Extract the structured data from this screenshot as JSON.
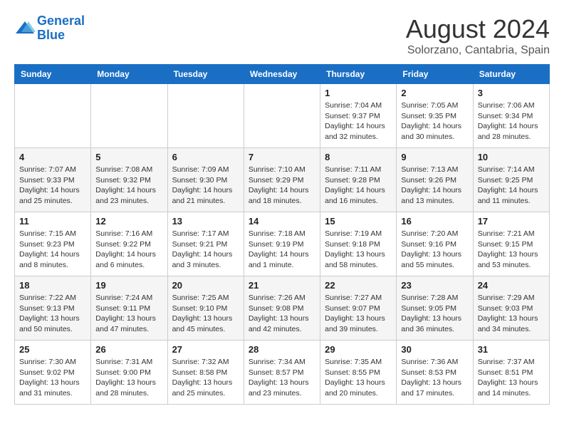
{
  "header": {
    "logo_line1": "General",
    "logo_line2": "Blue",
    "month_year": "August 2024",
    "location": "Solorzano, Cantabria, Spain"
  },
  "days_of_week": [
    "Sunday",
    "Monday",
    "Tuesday",
    "Wednesday",
    "Thursday",
    "Friday",
    "Saturday"
  ],
  "weeks": [
    [
      {
        "day": "",
        "info": ""
      },
      {
        "day": "",
        "info": ""
      },
      {
        "day": "",
        "info": ""
      },
      {
        "day": "",
        "info": ""
      },
      {
        "day": "1",
        "info": "Sunrise: 7:04 AM\nSunset: 9:37 PM\nDaylight: 14 hours\nand 32 minutes."
      },
      {
        "day": "2",
        "info": "Sunrise: 7:05 AM\nSunset: 9:35 PM\nDaylight: 14 hours\nand 30 minutes."
      },
      {
        "day": "3",
        "info": "Sunrise: 7:06 AM\nSunset: 9:34 PM\nDaylight: 14 hours\nand 28 minutes."
      }
    ],
    [
      {
        "day": "4",
        "info": "Sunrise: 7:07 AM\nSunset: 9:33 PM\nDaylight: 14 hours\nand 25 minutes."
      },
      {
        "day": "5",
        "info": "Sunrise: 7:08 AM\nSunset: 9:32 PM\nDaylight: 14 hours\nand 23 minutes."
      },
      {
        "day": "6",
        "info": "Sunrise: 7:09 AM\nSunset: 9:30 PM\nDaylight: 14 hours\nand 21 minutes."
      },
      {
        "day": "7",
        "info": "Sunrise: 7:10 AM\nSunset: 9:29 PM\nDaylight: 14 hours\nand 18 minutes."
      },
      {
        "day": "8",
        "info": "Sunrise: 7:11 AM\nSunset: 9:28 PM\nDaylight: 14 hours\nand 16 minutes."
      },
      {
        "day": "9",
        "info": "Sunrise: 7:13 AM\nSunset: 9:26 PM\nDaylight: 14 hours\nand 13 minutes."
      },
      {
        "day": "10",
        "info": "Sunrise: 7:14 AM\nSunset: 9:25 PM\nDaylight: 14 hours\nand 11 minutes."
      }
    ],
    [
      {
        "day": "11",
        "info": "Sunrise: 7:15 AM\nSunset: 9:23 PM\nDaylight: 14 hours\nand 8 minutes."
      },
      {
        "day": "12",
        "info": "Sunrise: 7:16 AM\nSunset: 9:22 PM\nDaylight: 14 hours\nand 6 minutes."
      },
      {
        "day": "13",
        "info": "Sunrise: 7:17 AM\nSunset: 9:21 PM\nDaylight: 14 hours\nand 3 minutes."
      },
      {
        "day": "14",
        "info": "Sunrise: 7:18 AM\nSunset: 9:19 PM\nDaylight: 14 hours\nand 1 minute."
      },
      {
        "day": "15",
        "info": "Sunrise: 7:19 AM\nSunset: 9:18 PM\nDaylight: 13 hours\nand 58 minutes."
      },
      {
        "day": "16",
        "info": "Sunrise: 7:20 AM\nSunset: 9:16 PM\nDaylight: 13 hours\nand 55 minutes."
      },
      {
        "day": "17",
        "info": "Sunrise: 7:21 AM\nSunset: 9:15 PM\nDaylight: 13 hours\nand 53 minutes."
      }
    ],
    [
      {
        "day": "18",
        "info": "Sunrise: 7:22 AM\nSunset: 9:13 PM\nDaylight: 13 hours\nand 50 minutes."
      },
      {
        "day": "19",
        "info": "Sunrise: 7:24 AM\nSunset: 9:11 PM\nDaylight: 13 hours\nand 47 minutes."
      },
      {
        "day": "20",
        "info": "Sunrise: 7:25 AM\nSunset: 9:10 PM\nDaylight: 13 hours\nand 45 minutes."
      },
      {
        "day": "21",
        "info": "Sunrise: 7:26 AM\nSunset: 9:08 PM\nDaylight: 13 hours\nand 42 minutes."
      },
      {
        "day": "22",
        "info": "Sunrise: 7:27 AM\nSunset: 9:07 PM\nDaylight: 13 hours\nand 39 minutes."
      },
      {
        "day": "23",
        "info": "Sunrise: 7:28 AM\nSunset: 9:05 PM\nDaylight: 13 hours\nand 36 minutes."
      },
      {
        "day": "24",
        "info": "Sunrise: 7:29 AM\nSunset: 9:03 PM\nDaylight: 13 hours\nand 34 minutes."
      }
    ],
    [
      {
        "day": "25",
        "info": "Sunrise: 7:30 AM\nSunset: 9:02 PM\nDaylight: 13 hours\nand 31 minutes."
      },
      {
        "day": "26",
        "info": "Sunrise: 7:31 AM\nSunset: 9:00 PM\nDaylight: 13 hours\nand 28 minutes."
      },
      {
        "day": "27",
        "info": "Sunrise: 7:32 AM\nSunset: 8:58 PM\nDaylight: 13 hours\nand 25 minutes."
      },
      {
        "day": "28",
        "info": "Sunrise: 7:34 AM\nSunset: 8:57 PM\nDaylight: 13 hours\nand 23 minutes."
      },
      {
        "day": "29",
        "info": "Sunrise: 7:35 AM\nSunset: 8:55 PM\nDaylight: 13 hours\nand 20 minutes."
      },
      {
        "day": "30",
        "info": "Sunrise: 7:36 AM\nSunset: 8:53 PM\nDaylight: 13 hours\nand 17 minutes."
      },
      {
        "day": "31",
        "info": "Sunrise: 7:37 AM\nSunset: 8:51 PM\nDaylight: 13 hours\nand 14 minutes."
      }
    ]
  ]
}
